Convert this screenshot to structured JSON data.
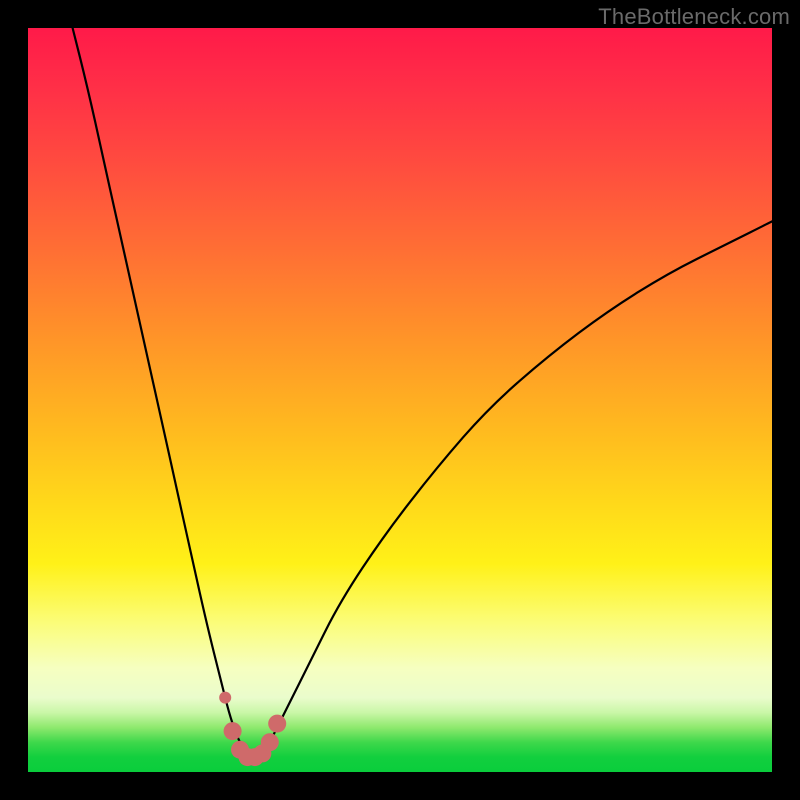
{
  "watermark": "TheBottleneck.com",
  "colors": {
    "frame": "#000000",
    "curve_stroke": "#000000",
    "marker_fill": "#cf6a6a",
    "marker_stroke": "#cf6a6a"
  },
  "chart_data": {
    "type": "line",
    "title": "",
    "xlabel": "",
    "ylabel": "",
    "xlim": [
      0,
      100
    ],
    "ylim": [
      0,
      100
    ],
    "series": [
      {
        "name": "bottleneck-curve",
        "x": [
          6,
          8,
          10,
          12,
          14,
          16,
          18,
          20,
          22,
          24,
          26,
          27,
          28,
          29,
          30,
          31,
          32,
          33,
          35,
          38,
          42,
          48,
          55,
          62,
          70,
          78,
          86,
          94,
          100
        ],
        "y": [
          100,
          92,
          83,
          74,
          65,
          56,
          47,
          38,
          29,
          20,
          12,
          8,
          5,
          3,
          2,
          2,
          3,
          5,
          9,
          15,
          23,
          32,
          41,
          49,
          56,
          62,
          67,
          71,
          74
        ]
      }
    ],
    "markers": [
      {
        "x": 26.5,
        "y": 10
      },
      {
        "x": 27.5,
        "y": 5.5
      },
      {
        "x": 28.5,
        "y": 3
      },
      {
        "x": 29.5,
        "y": 2
      },
      {
        "x": 30.5,
        "y": 2
      },
      {
        "x": 31.5,
        "y": 2.5
      },
      {
        "x": 32.5,
        "y": 4
      },
      {
        "x": 33.5,
        "y": 6.5
      }
    ]
  }
}
